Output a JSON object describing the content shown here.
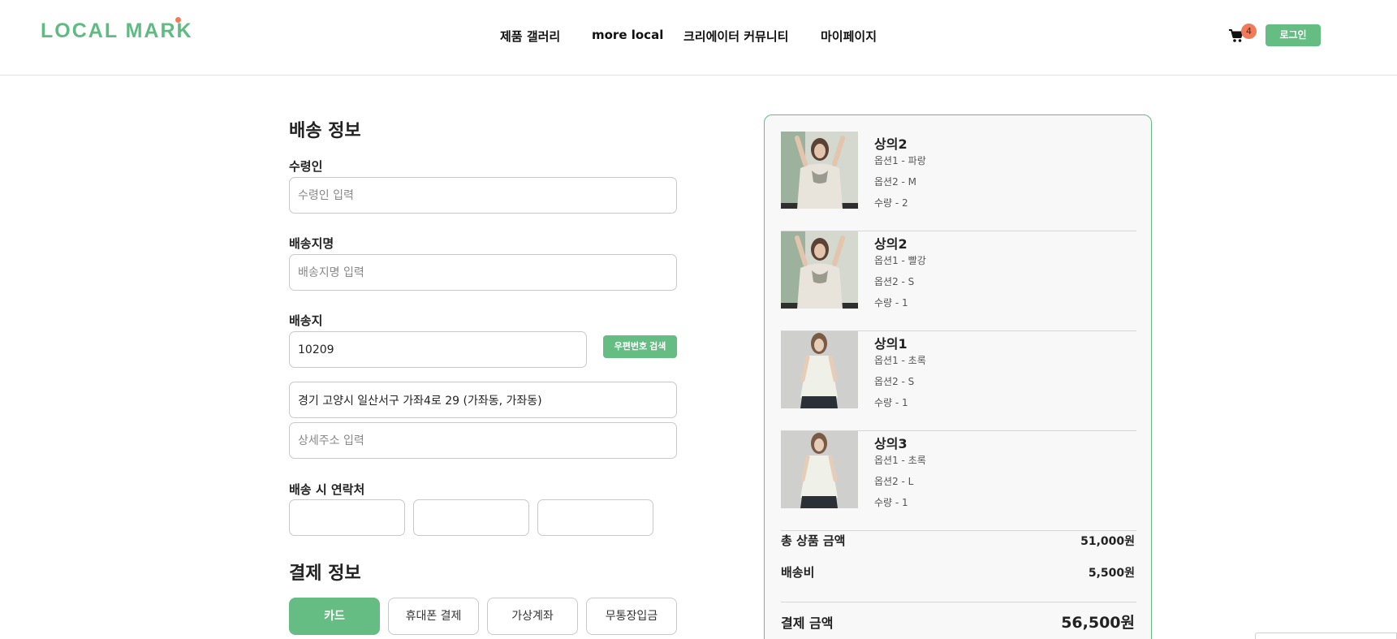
{
  "header": {
    "logo": "LOCAL MARK",
    "nav": [
      "제품 갤러리",
      "more local",
      "크리에이터 커뮤니티",
      "마이페이지"
    ],
    "cart_count": "4",
    "login_label": "로그인",
    "brand_color": "#66bd84",
    "badge_color": "#f07a5a"
  },
  "shipping": {
    "title": "배송 정보",
    "recipient_label": "수령인",
    "recipient_placeholder": "수령인 입력",
    "recipient_value": "",
    "place_name_label": "배송지명",
    "place_name_placeholder": "배송지명 입력",
    "address_label": "배송지",
    "zipcode_value": "10209",
    "zip_search_label": "우편번호 검색",
    "address_value": "경기 고양시 일산서구 가좌4로 29 (가좌동, 가좌동)",
    "detail_placeholder": "상세주소 입력",
    "contact_label": "배송 시 연락처"
  },
  "payment": {
    "title": "결제 정보",
    "methods": [
      "카드",
      "휴대폰 결제",
      "가상계좌",
      "무통장입금"
    ],
    "selected": "카드"
  },
  "order": {
    "items": [
      {
        "name": "상의2",
        "opt1": "옵션1 - 파랑",
        "opt2": "옵션2 - M",
        "qty": "수량 - 2"
      },
      {
        "name": "상의2",
        "opt1": "옵션1 - 빨강",
        "opt2": "옵션2 - S",
        "qty": "수량 - 1"
      },
      {
        "name": "상의1",
        "opt1": "옵션1 - 초록",
        "opt2": "옵션2 - S",
        "qty": "수량 - 1"
      },
      {
        "name": "상의3",
        "opt1": "옵션1 - 초록",
        "opt2": "옵션2 - L",
        "qty": "수량 - 1"
      }
    ],
    "subtotal_label": "총 상품 금액",
    "subtotal_value": "51,000원",
    "shipping_label": "배송비",
    "shipping_value": "5,500원",
    "total_label": "결제 금액",
    "total_value": "56,500원"
  }
}
